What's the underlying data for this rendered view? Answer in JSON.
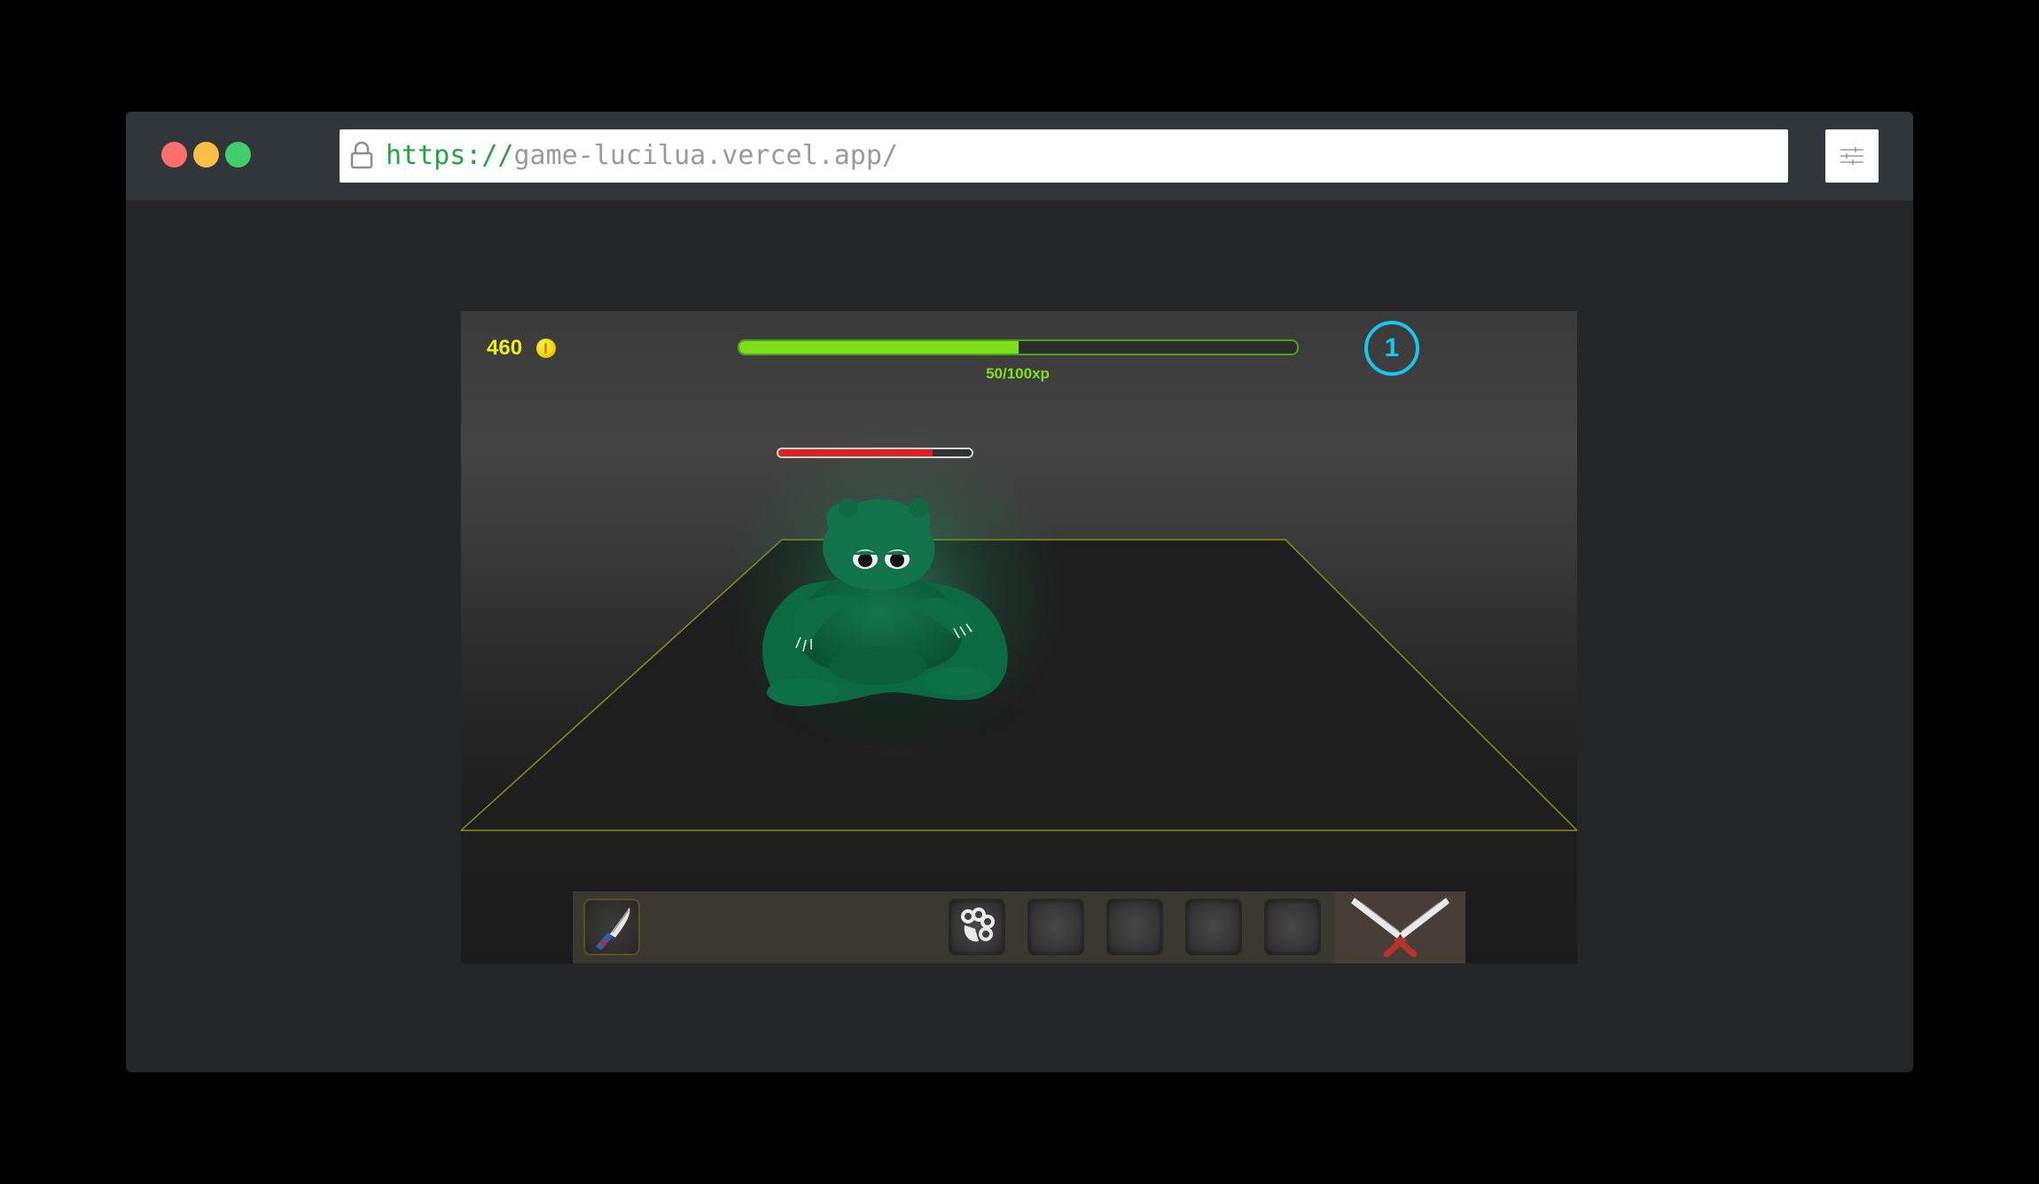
{
  "browser": {
    "url_scheme": "https://",
    "url_host": "game-lucilua.vercel.app/"
  },
  "hud": {
    "coins": "460",
    "xp_label": "50/100xp",
    "xp_fraction": 0.5,
    "level": "1",
    "enemy_health_fraction": 0.8
  },
  "hotbar": {
    "slots": [
      {
        "icon": "knife-icon",
        "state": "equipped"
      },
      {
        "icon": "brass-knuckles-icon",
        "state": "filled"
      },
      {
        "icon": "",
        "state": "empty"
      },
      {
        "icon": "",
        "state": "empty"
      },
      {
        "icon": "",
        "state": "empty"
      },
      {
        "icon": "",
        "state": "empty"
      }
    ],
    "attack_icon": "crossed-knives-icon"
  },
  "colors": {
    "coin_text": "#e8ef1c",
    "xp_green": "#7fe01a",
    "level_cyan": "#19c7ee",
    "enemy_health_red": "#e0201c",
    "arena_edge": "#8a8f10",
    "monster_green": "#0f7a4c"
  }
}
